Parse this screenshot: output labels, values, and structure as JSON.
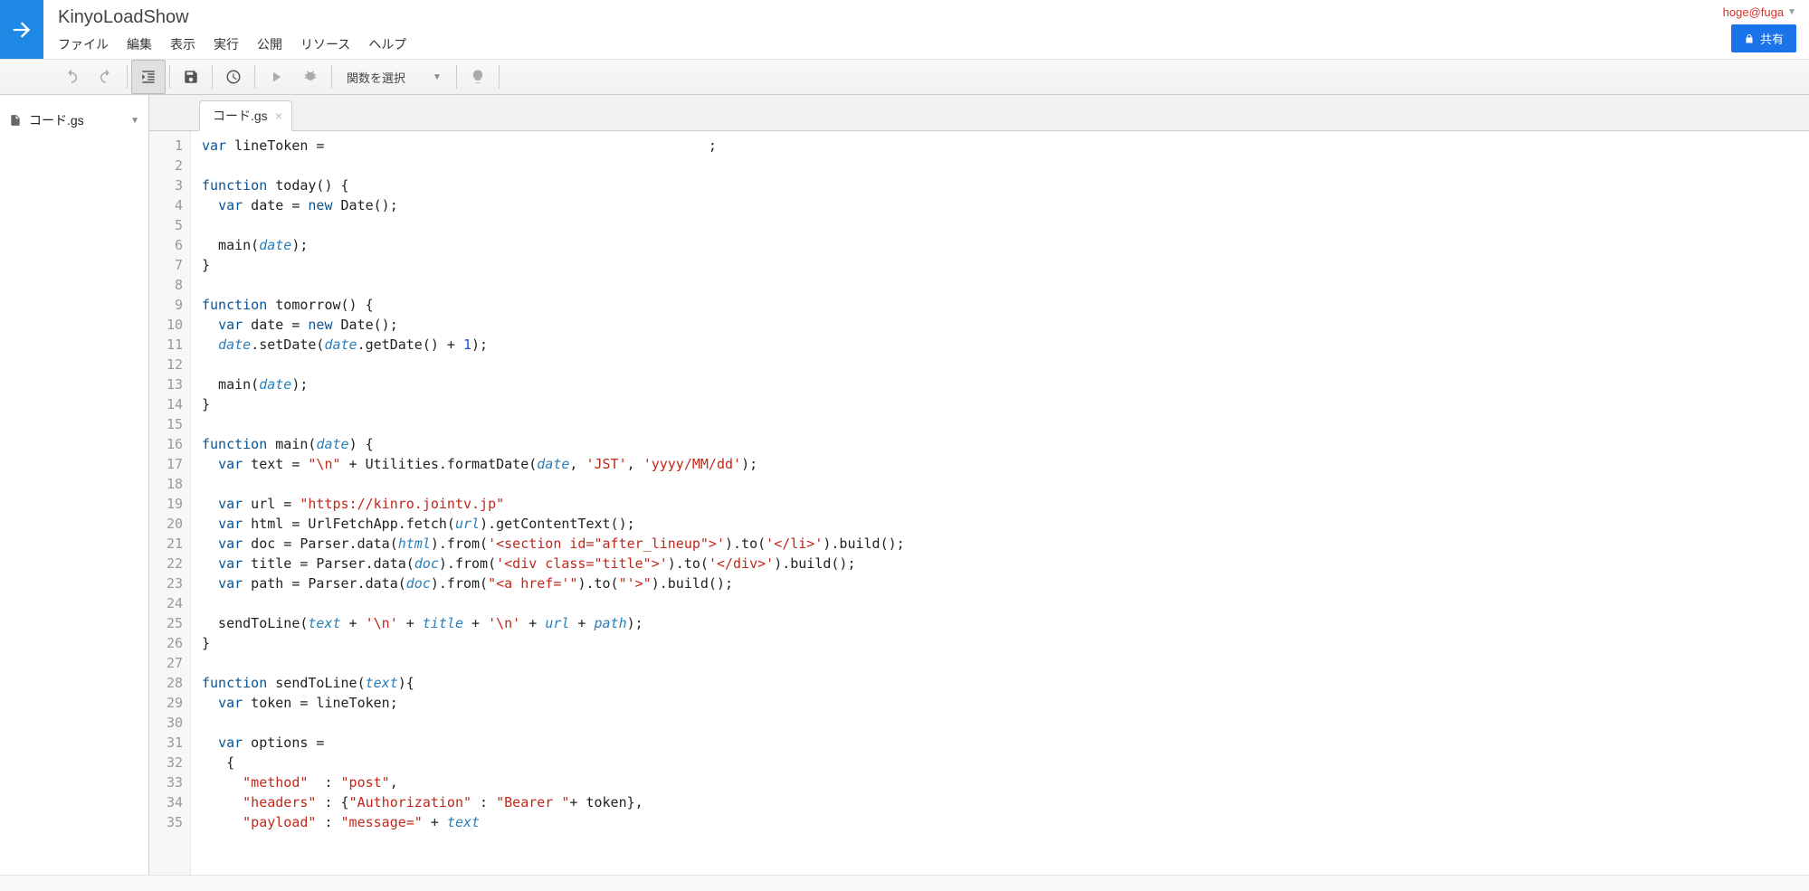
{
  "header": {
    "project_title": "KinyoLoadShow",
    "user_email": "hoge@fuga",
    "share_label": "共有"
  },
  "menubar": [
    "ファイル",
    "編集",
    "表示",
    "実行",
    "公開",
    "リソース",
    "ヘルプ"
  ],
  "toolbar": {
    "function_selector_label": "関数を選択"
  },
  "sidebar": {
    "files": [
      {
        "name": "コード.gs"
      }
    ]
  },
  "tabs": [
    {
      "name": "コード.gs"
    }
  ],
  "code": {
    "lines": [
      [
        {
          "t": "var",
          "c": "kw"
        },
        {
          "t": " lineToken = "
        },
        {
          "t": "                                              ",
          "c": "hidden-token"
        },
        {
          "t": ";"
        }
      ],
      [],
      [
        {
          "t": "function",
          "c": "kw"
        },
        {
          "t": " today() {"
        }
      ],
      [
        {
          "t": "  "
        },
        {
          "t": "var",
          "c": "kw"
        },
        {
          "t": " date = "
        },
        {
          "t": "new",
          "c": "kw"
        },
        {
          "t": " Date();"
        }
      ],
      [
        {
          "t": "  "
        }
      ],
      [
        {
          "t": "  main("
        },
        {
          "t": "date",
          "c": "ident"
        },
        {
          "t": ");"
        }
      ],
      [
        {
          "t": "}"
        }
      ],
      [],
      [
        {
          "t": "function",
          "c": "kw"
        },
        {
          "t": " tomorrow() {"
        }
      ],
      [
        {
          "t": "  "
        },
        {
          "t": "var",
          "c": "kw"
        },
        {
          "t": " date = "
        },
        {
          "t": "new",
          "c": "kw"
        },
        {
          "t": " Date();"
        }
      ],
      [
        {
          "t": "  "
        },
        {
          "t": "date",
          "c": "ident"
        },
        {
          "t": ".setDate("
        },
        {
          "t": "date",
          "c": "ident"
        },
        {
          "t": ".getDate() + "
        },
        {
          "t": "1",
          "c": "num"
        },
        {
          "t": ");"
        }
      ],
      [],
      [
        {
          "t": "  main("
        },
        {
          "t": "date",
          "c": "ident"
        },
        {
          "t": ");"
        }
      ],
      [
        {
          "t": "}"
        }
      ],
      [],
      [
        {
          "t": "function",
          "c": "kw"
        },
        {
          "t": " main("
        },
        {
          "t": "date",
          "c": "ident"
        },
        {
          "t": ") {"
        }
      ],
      [
        {
          "t": "  "
        },
        {
          "t": "var",
          "c": "kw"
        },
        {
          "t": " text = "
        },
        {
          "t": "\"\\n\"",
          "c": "str"
        },
        {
          "t": " + Utilities.formatDate("
        },
        {
          "t": "date",
          "c": "ident"
        },
        {
          "t": ", "
        },
        {
          "t": "'JST'",
          "c": "str"
        },
        {
          "t": ", "
        },
        {
          "t": "'yyyy/MM/dd'",
          "c": "str"
        },
        {
          "t": ");"
        }
      ],
      [],
      [
        {
          "t": "  "
        },
        {
          "t": "var",
          "c": "kw"
        },
        {
          "t": " url = "
        },
        {
          "t": "\"https://kinro.jointv.jp\"",
          "c": "str"
        }
      ],
      [
        {
          "t": "  "
        },
        {
          "t": "var",
          "c": "kw"
        },
        {
          "t": " html = UrlFetchApp.fetch("
        },
        {
          "t": "url",
          "c": "ident"
        },
        {
          "t": ").getContentText();"
        }
      ],
      [
        {
          "t": "  "
        },
        {
          "t": "var",
          "c": "kw"
        },
        {
          "t": " doc = Parser.data("
        },
        {
          "t": "html",
          "c": "ident"
        },
        {
          "t": ").from("
        },
        {
          "t": "'<section id=\"after_lineup\">'",
          "c": "str"
        },
        {
          "t": ").to("
        },
        {
          "t": "'</li>'",
          "c": "str"
        },
        {
          "t": ").build();"
        }
      ],
      [
        {
          "t": "  "
        },
        {
          "t": "var",
          "c": "kw"
        },
        {
          "t": " title = Parser.data("
        },
        {
          "t": "doc",
          "c": "ident"
        },
        {
          "t": ").from("
        },
        {
          "t": "'<div class=\"title\">'",
          "c": "str"
        },
        {
          "t": ").to("
        },
        {
          "t": "'</div>'",
          "c": "str"
        },
        {
          "t": ").build();"
        }
      ],
      [
        {
          "t": "  "
        },
        {
          "t": "var",
          "c": "kw"
        },
        {
          "t": " path = Parser.data("
        },
        {
          "t": "doc",
          "c": "ident"
        },
        {
          "t": ").from("
        },
        {
          "t": "\"<a href='\"",
          "c": "str"
        },
        {
          "t": ").to("
        },
        {
          "t": "\"'>\"",
          "c": "str"
        },
        {
          "t": ").build();"
        }
      ],
      [],
      [
        {
          "t": "  sendToLine("
        },
        {
          "t": "text",
          "c": "ident"
        },
        {
          "t": " + "
        },
        {
          "t": "'\\n'",
          "c": "str"
        },
        {
          "t": " + "
        },
        {
          "t": "title",
          "c": "ident"
        },
        {
          "t": " + "
        },
        {
          "t": "'\\n'",
          "c": "str"
        },
        {
          "t": " + "
        },
        {
          "t": "url",
          "c": "ident"
        },
        {
          "t": " + "
        },
        {
          "t": "path",
          "c": "ident"
        },
        {
          "t": ");"
        }
      ],
      [
        {
          "t": "}"
        }
      ],
      [],
      [
        {
          "t": "function",
          "c": "kw"
        },
        {
          "t": " sendToLine("
        },
        {
          "t": "text",
          "c": "ident"
        },
        {
          "t": "){"
        }
      ],
      [
        {
          "t": "  "
        },
        {
          "t": "var",
          "c": "kw"
        },
        {
          "t": " token = lineToken;"
        }
      ],
      [],
      [
        {
          "t": "  "
        },
        {
          "t": "var",
          "c": "kw"
        },
        {
          "t": " options ="
        }
      ],
      [
        {
          "t": "   {"
        }
      ],
      [
        {
          "t": "     "
        },
        {
          "t": "\"method\"",
          "c": "str"
        },
        {
          "t": "  : "
        },
        {
          "t": "\"post\"",
          "c": "str"
        },
        {
          "t": ","
        }
      ],
      [
        {
          "t": "     "
        },
        {
          "t": "\"headers\"",
          "c": "str"
        },
        {
          "t": " : {"
        },
        {
          "t": "\"Authorization\"",
          "c": "str"
        },
        {
          "t": " : "
        },
        {
          "t": "\"Bearer \"",
          "c": "str"
        },
        {
          "t": "+ token},"
        }
      ],
      [
        {
          "t": "     "
        },
        {
          "t": "\"payload\"",
          "c": "str"
        },
        {
          "t": " : "
        },
        {
          "t": "\"message=\"",
          "c": "str"
        },
        {
          "t": " + "
        },
        {
          "t": "text",
          "c": "ident"
        }
      ]
    ]
  }
}
